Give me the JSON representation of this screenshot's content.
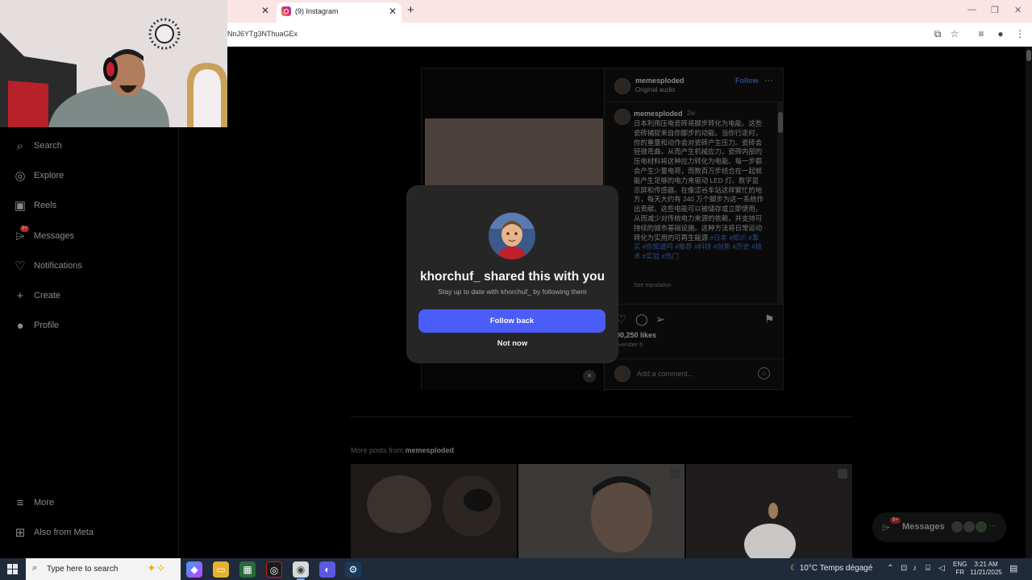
{
  "browser": {
    "tab_title": "(9) Instagram",
    "url": "NnJ6YTg3NThuaGEx",
    "close_glyph": "✕",
    "new_tab_glyph": "+"
  },
  "sidebar": {
    "items": [
      {
        "label": "Search",
        "icon": "search-icon"
      },
      {
        "label": "Explore",
        "icon": "compass-icon"
      },
      {
        "label": "Reels",
        "icon": "reels-icon"
      },
      {
        "label": "Messages",
        "icon": "messenger-icon",
        "badge": "9+"
      },
      {
        "label": "Notifications",
        "icon": "heart-icon"
      },
      {
        "label": "Create",
        "icon": "plus-icon"
      },
      {
        "label": "Profile",
        "icon": "avatar-icon"
      }
    ],
    "bottom": [
      {
        "label": "More",
        "icon": "menu-icon"
      },
      {
        "label": "Also from Meta",
        "icon": "meta-icon"
      }
    ]
  },
  "post": {
    "username": "memesploded",
    "audio": "Original audio",
    "follow": "Follow",
    "caption_user": "memesploded",
    "caption_time": "2w",
    "caption_text": "日本利用压电瓷砖将脚步转化为电能。这些瓷砖捕捉来自你脚步的动能。当你行走时，你的重量和动作会对瓷砖产生压力。瓷砖会轻微弯曲，从而产生机械应力。瓷砖内部的压电材料将这种应力转化为电能。每一步都会产生少量电荷，而数百万步结合在一起就能产生足够的电力来驱动 LED 灯、数字显示屏和传感器。在像涩谷车站这样繁忙的地方，每天大约有 240 万个脚步为这一系统作出贡献。这些电能可以被储存或立即使用，从而减少对传统电力来源的依赖，并支持可持续的城市基础设施。这种方法将日常运动转化为实用的可再生能源",
    "caption_tags": "#日本 #知识 #事实 #你知道吗 #推荐 #科技 #创新 #历史 #技术 #实验 #热门",
    "see_translation": "See translation",
    "likes": "00,250 likes",
    "date": "ovember 6",
    "comment_placeholder": "Add a comment...",
    "more_posts_prefix": "More posts from ",
    "more_posts_user": "memesploded"
  },
  "modal": {
    "title": "khorchuf_ shared this with you",
    "subtitle": "Stay up to date with khorchuf_ by following them",
    "follow_back": "Follow back",
    "not_now": "Not now"
  },
  "messages_pill": {
    "label": "Messages",
    "badge": "9+"
  },
  "taskbar": {
    "search_placeholder": "Type here to search",
    "weather": "10°C  Temps dégagé",
    "lang_top": "ENG",
    "lang_bottom": "FR",
    "time": "3:21 AM",
    "date": "11/21/2025"
  },
  "colors": {
    "accent": "#4a5df9",
    "modal_bg": "#262626",
    "tab_bar": "#fbe4e4",
    "taskbar": "#1f2a3a"
  }
}
